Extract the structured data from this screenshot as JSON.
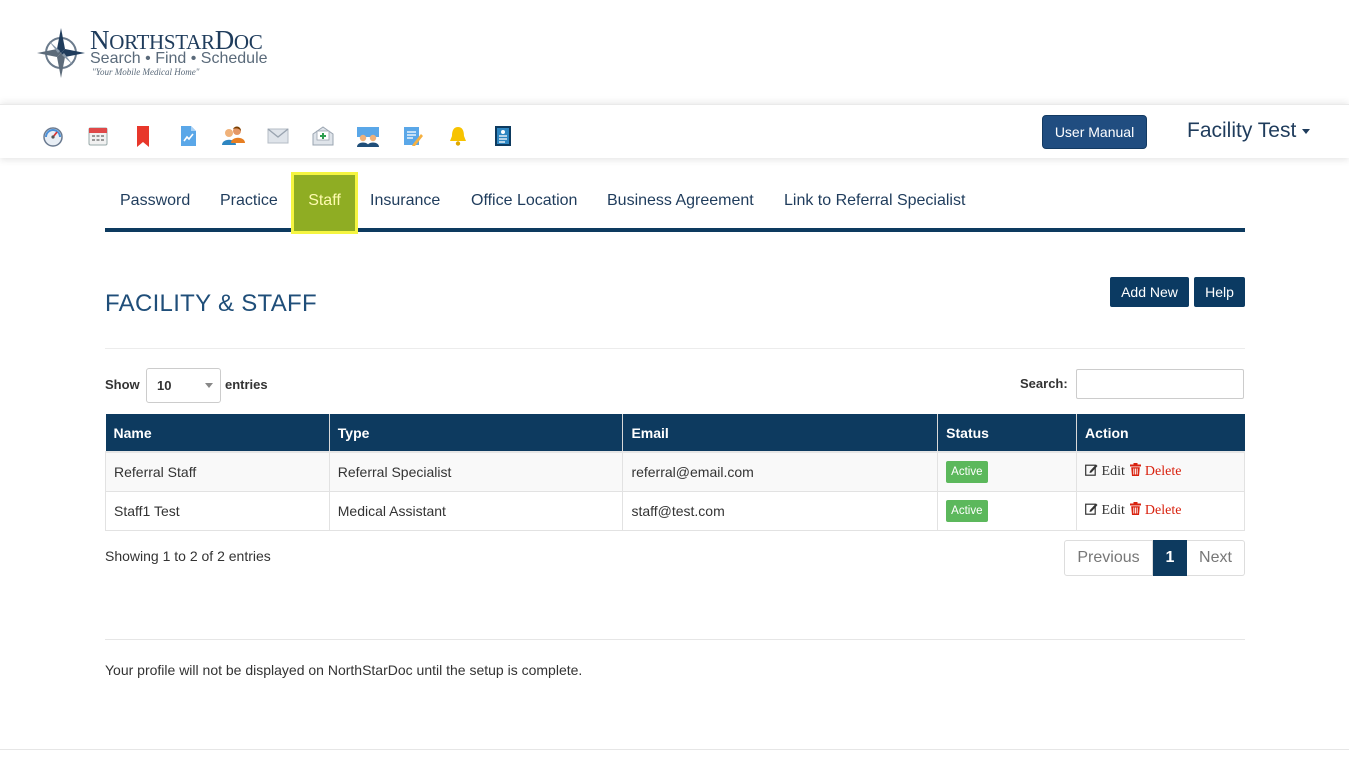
{
  "brand": {
    "name_cap1": "N",
    "name_rest1": "ORTHSTAR",
    "name_cap2": "D",
    "name_rest2": "OC",
    "tagline": "Search • Find • Schedule",
    "motto": "\"Your Mobile Medical Home\""
  },
  "toolbar": {
    "icons": [
      "dashboard-gauge-icon",
      "calendar-icon",
      "bookmark-icon",
      "report-document-icon",
      "users-icon",
      "mail-icon",
      "medical-inbox-icon",
      "team-icon",
      "notes-edit-icon",
      "bell-icon",
      "contacts-list-icon"
    ],
    "user_manual": "User Manual",
    "user_name": "Facility Test"
  },
  "tabs": [
    "Password",
    "Practice",
    "Staff",
    "Insurance",
    "Office Location",
    "Business Agreement",
    "Link to Referral Specialist"
  ],
  "active_tab": "Staff",
  "page": {
    "title": "FACILITY & STAFF",
    "add_new": "Add New",
    "help": "Help"
  },
  "table_controls": {
    "show": "Show",
    "entries_value": "10",
    "entries": "entries",
    "search_label": "Search:",
    "search_value": ""
  },
  "table": {
    "columns": [
      "Name",
      "Type",
      "Email",
      "Status",
      "Action"
    ],
    "rows": [
      {
        "name": "Referral Staff",
        "type": "Referral Specialist",
        "email": "referral@email.com",
        "status": "Active",
        "edit": "Edit",
        "delete": "Delete"
      },
      {
        "name": "Staff1 Test",
        "type": "Medical Assistant",
        "email": "staff@test.com",
        "status": "Active",
        "edit": "Edit",
        "delete": "Delete"
      }
    ]
  },
  "pagination": {
    "info": "Showing 1 to 2 of 2 entries",
    "previous": "Previous",
    "current": "1",
    "next": "Next"
  },
  "notice": "Your profile will not be displayed on NorthStarDoc until the setup is complete.",
  "colors": {
    "navy": "#0d3a5f",
    "active_tab_bg": "#8fad23",
    "active_tab_border": "#f5f541",
    "status_active": "#5cb85c",
    "delete_red": "#d9220f"
  }
}
